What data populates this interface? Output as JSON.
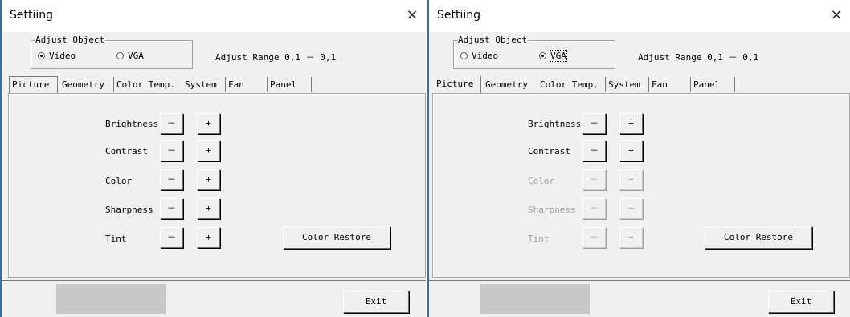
{
  "windows": [
    {
      "title": "Settiing",
      "close_icon": "×",
      "adjust_object": {
        "legend": "Adjust Object",
        "options": [
          "Video",
          "VGA"
        ],
        "selected": "Video"
      },
      "adjust_range": "Adjust Range 0,1 － 0,1",
      "tabs": [
        "Picture",
        "Geometry",
        "Color Temp.",
        "System",
        "Fan",
        "Panel"
      ],
      "active_tab": "Picture",
      "controls": [
        {
          "label": "Brightness",
          "minus": "－",
          "plus": "+",
          "enabled": true
        },
        {
          "label": "Contrast",
          "minus": "－",
          "plus": "+",
          "enabled": true
        },
        {
          "label": "Color",
          "minus": "－",
          "plus": "+",
          "enabled": true
        },
        {
          "label": "Sharpness",
          "minus": "－",
          "plus": "+",
          "enabled": true
        },
        {
          "label": "Tint",
          "minus": "－",
          "plus": "+",
          "enabled": true
        }
      ],
      "color_restore": "Color Restore",
      "exit": "Exit"
    },
    {
      "title": "Settiing",
      "close_icon": "×",
      "adjust_object": {
        "legend": "Adjust Object",
        "options": [
          "Video",
          "VGA"
        ],
        "selected": "VGA"
      },
      "adjust_range": "Adjust Range 0,1 － 0,1",
      "tabs": [
        "Picture",
        "Geometry",
        "Color Temp.",
        "System",
        "Fan",
        "Panel"
      ],
      "active_tab": "Picture",
      "controls": [
        {
          "label": "Brightness",
          "minus": "－",
          "plus": "+",
          "enabled": true
        },
        {
          "label": "Contrast",
          "minus": "－",
          "plus": "+",
          "enabled": true
        },
        {
          "label": "Color",
          "minus": "－",
          "plus": "+",
          "enabled": false
        },
        {
          "label": "Sharpness",
          "minus": "－",
          "plus": "+",
          "enabled": false
        },
        {
          "label": "Tint",
          "minus": "－",
          "plus": "+",
          "enabled": false
        }
      ],
      "color_restore": "Color Restore",
      "exit": "Exit"
    }
  ]
}
